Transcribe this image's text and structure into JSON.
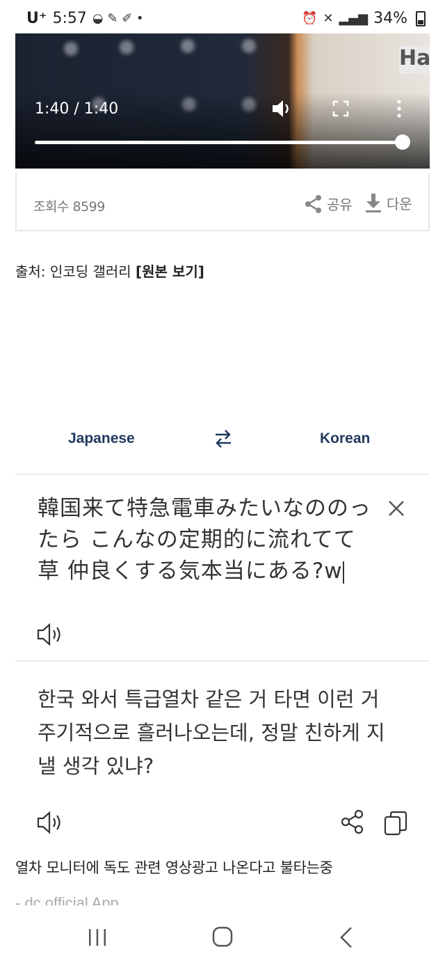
{
  "status_bar": {
    "carrier": "U⁺",
    "time": "5:57",
    "battery": "34%"
  },
  "video": {
    "time": "1:40 / 1:40",
    "progress": 1.0,
    "hint_text": "Ha"
  },
  "meta": {
    "views": "조회수 8599",
    "share_label": "공유",
    "download_label": "다운"
  },
  "source": {
    "prefix": "출처: 인코딩 갤러리 ",
    "link": "[원본 보기]"
  },
  "translator": {
    "source_lang": "Japanese",
    "target_lang": "Korean",
    "source_text": "韓国来て特急電車みたいなののったら こんなの定期的に流れてて 草 仲良くする気本当にある?w",
    "target_text": "한국 와서 특급열차 같은 거 타면 이런 거 주기적으로 흘러나오는데, 정말 친하게 지낼 생각 있냐?"
  },
  "caption": "열차 모니터에 독도 관련 영상광고 나온다고 불타는중",
  "app_tag": "- dc official App"
}
